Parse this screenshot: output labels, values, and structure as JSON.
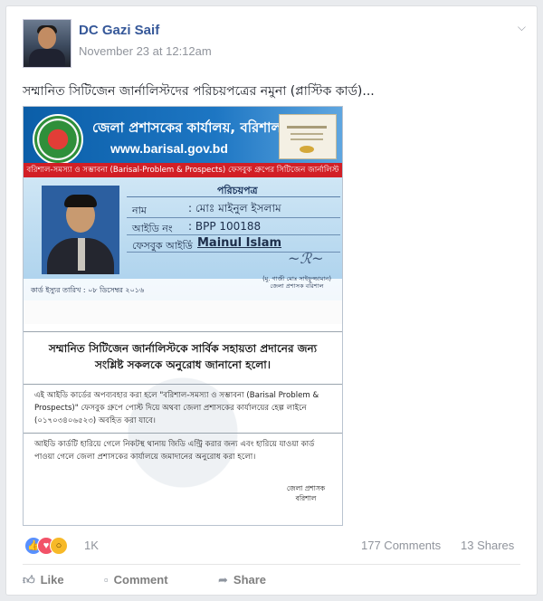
{
  "post": {
    "author": "DC Gazi Saif",
    "timestamp": "November 23 at 12:12am",
    "text": "সম্মানিত সিটিজেন জার্নালিস্টদের পরিচয়পত্রের নমুনা (প্লাস্টিক কার্ড)..."
  },
  "card": {
    "office": "জেলা প্রশাসকের কার্যালয়, বরিশাল",
    "url": "www.barisal.gov.bd",
    "banner": "বরিশাল-সমস্যা ও সম্ভাবনা (Barisal-Problem & Prospects) ফেসবুক গ্রুপের সিটিজেন জার্নালিস্ট",
    "heading": "পরিচয়পত্র",
    "name_label": "নাম",
    "name_value": ": মোঃ মাইনুল ইসলাম",
    "id_label": "আইডি নং",
    "id_value": ": BPP 100188",
    "fb_label": "ফেসবুক আইডি",
    "fb_colon": ":",
    "fb_value": "Mainul Islam",
    "issue_date": "কার্ড ইস্যুর তারিখ : ০৮ ডিসেম্বর ২০১৬",
    "issuer": "(মু. গাজী মোঃ সাইফুজ্জামান) জেলা প্রশাসক বরিশাল",
    "back_title": "সম্মানিত সিটিজেন জার্নালিস্টকে সার্বিক সহায়তা প্রদানের জন্য সংশ্লিষ্ট সকলকে অনুরোধ জানানো হলো।",
    "back_p1": "এই আইডি কার্ডের অপব্যবহার করা হলে \"বরিশাল-সমস্যা ও সম্ভাবনা (Barisal Problem & Prospects)\" ফেসবুক গ্রুপে পোস্ট দিয়ে অথবা জেলা প্রশাসকের কার্যালয়ের হেল্প লাইনে (০১৭০৩৪০৬৫২৩) অবহিত করা যাবে।",
    "back_p2": "আইডি কার্ডটি হারিয়ে গেলে নিকটস্থ থানায় জিডি এন্ট্রি করার জন্য এবং হারিয়ে যাওয়া কার্ড পাওয়া গেলে জেলা প্রশাসকের কার্যালয়ে জমাদানের অনুরোধ করা হলো।",
    "back_sign": "জেলা প্রশাসক বরিশাল"
  },
  "engagement": {
    "reactions_count": "1K",
    "comments": "177 Comments",
    "shares": "13 Shares"
  },
  "actions": {
    "like": "Like",
    "comment": "Comment",
    "share": "Share"
  },
  "icons": {
    "like_reaction": "thumbs-up",
    "love_reaction": "heart",
    "wow_reaction": "wow-face",
    "menu": "chevron-down"
  },
  "colors": {
    "link": "#365899",
    "meta": "#90949c",
    "like": "#5890ff",
    "love": "#f25268",
    "wow": "#f7b928"
  }
}
